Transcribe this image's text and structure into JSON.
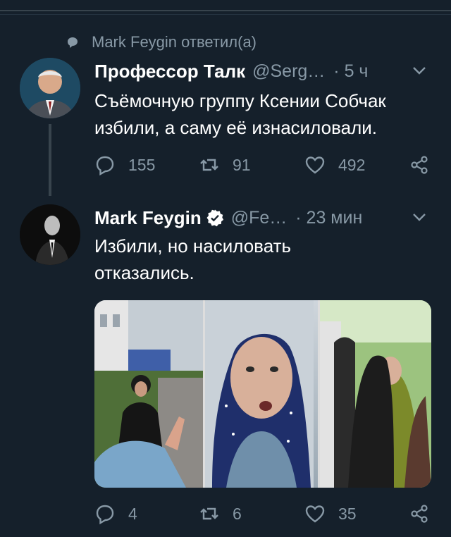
{
  "retweet_context": {
    "text": "Mark Feygin ответил(а)"
  },
  "tweets": [
    {
      "name": "Профессор Талк",
      "handle": "@Serg…",
      "time": "· 5 ч",
      "text_lines": [
        "Съёмочную группу Ксении Собчак",
        "избили, а саму её изнасиловали."
      ],
      "stats": {
        "replies": "155",
        "retweets": "91",
        "likes": "492"
      }
    },
    {
      "name": "Mark Feygin",
      "handle": "@Fe…",
      "time": "· 23 мин",
      "verified": true,
      "text_lines": [
        "Избили, но насиловать",
        "отказались."
      ],
      "stats": {
        "replies": "4",
        "retweets": "6",
        "likes": "35"
      }
    }
  ],
  "colors": {
    "background": "#15202b",
    "muted": "#8899a6",
    "text": "#ffffff",
    "divider": "#38444d"
  },
  "icons": [
    "comment-bubble-icon",
    "chevron-down-icon",
    "reply-icon",
    "retweet-icon",
    "like-icon",
    "share-icon",
    "verified-badge-icon"
  ]
}
